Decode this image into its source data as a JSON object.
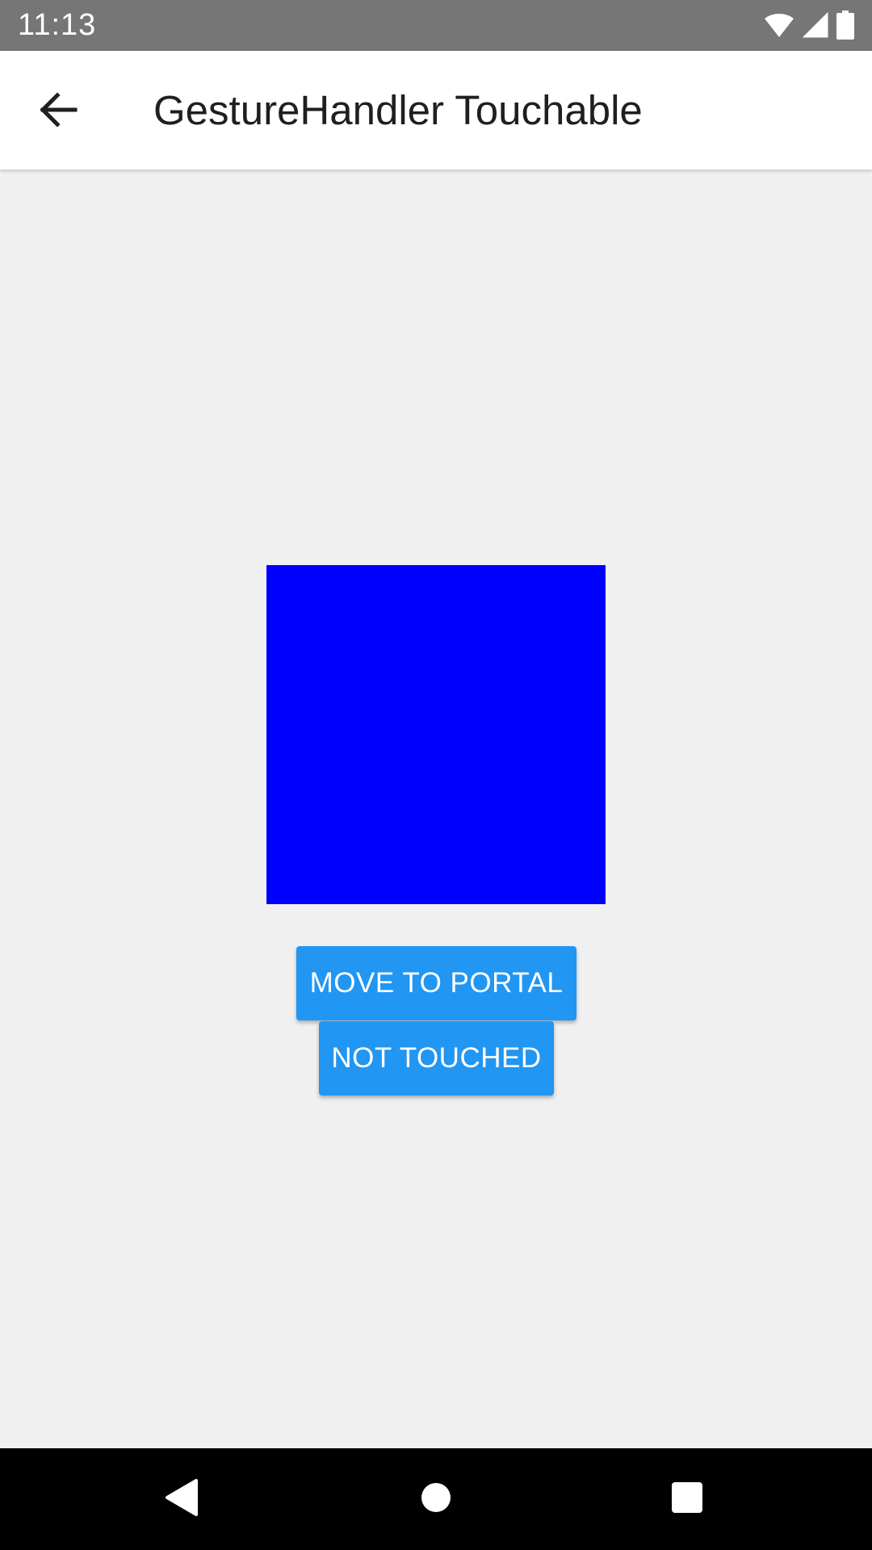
{
  "status_bar": {
    "time": "11:13",
    "icons": [
      "wifi-icon",
      "signal-icon",
      "battery-icon"
    ]
  },
  "app_bar": {
    "back_icon": "arrow-back-icon",
    "title": "GestureHandler Touchable"
  },
  "content": {
    "box_color": "#0000ff",
    "buttons": [
      {
        "label": "MOVE TO PORTAL"
      },
      {
        "label": "NOT TOUCHED"
      }
    ]
  },
  "nav_bar": {
    "items": [
      "back-triangle-icon",
      "home-circle-icon",
      "recents-square-icon"
    ]
  },
  "colors": {
    "status_bar": "#767676",
    "app_bar": "#ffffff",
    "background": "#f0f0f0",
    "button": "#2196f3",
    "nav_bar": "#000000"
  }
}
